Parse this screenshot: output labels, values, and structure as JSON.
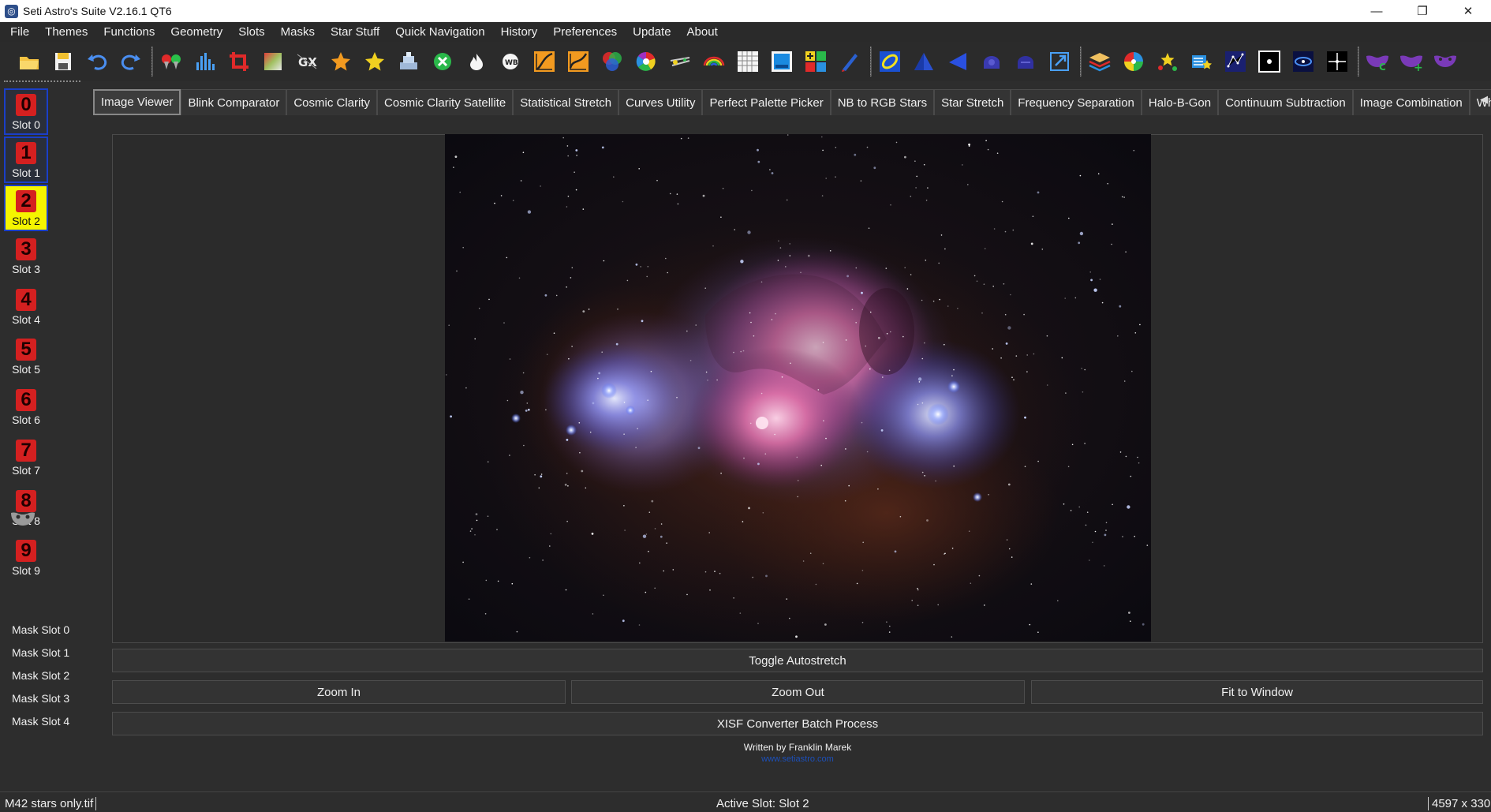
{
  "window": {
    "title": "Seti Astro's Suite V2.16.1 QT6",
    "minimize": "—",
    "restore": "❐",
    "close": "✕"
  },
  "menu": [
    "File",
    "Themes",
    "Functions",
    "Geometry",
    "Slots",
    "Masks",
    "Star Stuff",
    "Quick Navigation",
    "History",
    "Preferences",
    "Update",
    "About"
  ],
  "slots": [
    {
      "number": "0",
      "label": "Slot 0",
      "state": "selected-blue"
    },
    {
      "number": "1",
      "label": "Slot 1",
      "state": "selected-blue"
    },
    {
      "number": "2",
      "label": "Slot 2",
      "state": "active"
    },
    {
      "number": "3",
      "label": "Slot 3",
      "state": "normal"
    },
    {
      "number": "4",
      "label": "Slot 4",
      "state": "normal"
    },
    {
      "number": "5",
      "label": "Slot 5",
      "state": "normal"
    },
    {
      "number": "6",
      "label": "Slot 6",
      "state": "normal"
    },
    {
      "number": "7",
      "label": "Slot 7",
      "state": "normal"
    },
    {
      "number": "8",
      "label": "Slot 8",
      "state": "normal"
    },
    {
      "number": "9",
      "label": "Slot 9",
      "state": "normal"
    }
  ],
  "mask_slots": [
    "Mask Slot 0",
    "Mask Slot 1",
    "Mask Slot 2",
    "Mask Slot 3",
    "Mask Slot 4"
  ],
  "tabs": [
    "Image Viewer",
    "Blink Comparator",
    "Cosmic Clarity",
    "Cosmic Clarity Satellite",
    "Statistical Stretch",
    "Curves Utility",
    "Perfect Palette Picker",
    "NB to RGB Stars",
    "Star Stretch",
    "Frequency Separation",
    "Halo-B-Gon",
    "Continuum Subtraction",
    "Image Combination",
    "What'"
  ],
  "active_tab": "Image Viewer",
  "buttons": {
    "toggle_autostretch": "Toggle Autostretch",
    "zoom_in": "Zoom In",
    "zoom_out": "Zoom Out",
    "fit_to_window": "Fit to Window",
    "xisf_batch": "XISF Converter Batch Process"
  },
  "credit": "Written by Franklin Marek",
  "credit_link": "www.setiastro.com",
  "status": {
    "filename": "M42 stars only.tif",
    "active_slot": "Active Slot: Slot 2",
    "dimensions": "4597 x 330"
  },
  "toolbar_icons": [
    "open-folder-icon",
    "save-icon",
    "undo-icon",
    "redo-icon",
    "crop-pins-icon",
    "histogram-icon",
    "crop-icon",
    "gradient-icon",
    "gx-icon",
    "star-orange-icon",
    "star-yellow-icon",
    "stack-icon",
    "remove-green-icon",
    "flame-icon",
    "wb-icon",
    "curve-orange-icon",
    "curve-orange-2-icon",
    "rgb-circles-icon",
    "color-wheel-icon",
    "satellite-icon",
    "rainbow-icon",
    "grid-icon",
    "blue-square-icon",
    "mosaic-icon",
    "pen-icon",
    "yellow-ring-icon",
    "blue-pyramid-icon",
    "blue-triangle-icon",
    "purple-shape-icon",
    "purple-shape-2-icon",
    "expand-icon",
    "layers-icon",
    "pie-color-icon",
    "stars-multi-icon",
    "stars-bar-icon",
    "constellation-icon",
    "dark-star-icon",
    "galaxy-icon",
    "sparkle-icon",
    "mask-c-icon",
    "mask-plus-icon",
    "mask-purple-icon"
  ]
}
